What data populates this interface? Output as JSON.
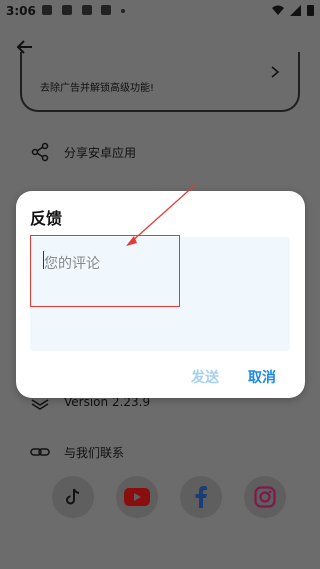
{
  "status_bar": {
    "time": "3:06"
  },
  "settings": {
    "premium_text": "去除广告并解锁高级功能!",
    "share_label": "分享安卓应用",
    "version_label": "Version 2.23.9",
    "contact_label": "与我们联系"
  },
  "social": {
    "tiktok": "TikTok",
    "youtube": "YouTube",
    "facebook": "Facebook",
    "instagram": "Instagram"
  },
  "dialog": {
    "title": "反馈",
    "comment_placeholder": "您的评论",
    "send_label": "发送",
    "cancel_label": "取消"
  },
  "colors": {
    "accent": "#1e88e5",
    "send_disabled": "#a6d0ef",
    "highlight": "#e53935",
    "input_bg": "#f0f7fd"
  }
}
